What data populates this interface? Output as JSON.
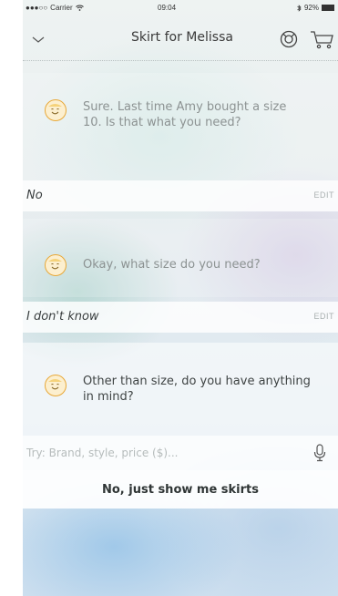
{
  "status_bar": {
    "signal": "●●●○○",
    "carrier": "Carrier",
    "time": "09:04",
    "battery_text": "92%"
  },
  "nav": {
    "title": "Skirt for Melissa"
  },
  "conversation": [
    {
      "bot": "Sure. Last time Amy bought a size 10. Is that what you need?",
      "answer": "No",
      "edit": "EDIT"
    },
    {
      "bot": "Okay, what size do you need?",
      "answer": "I don't know",
      "edit": "EDIT"
    },
    {
      "bot": "Other than size, do you have anything in mind?"
    }
  ],
  "input": {
    "placeholder": "Try: Brand, style, price ($)..."
  },
  "suggestion_button": "No, just show me skirts",
  "colors": {
    "avatar_ring": "#e8a838",
    "avatar_fill": "#fcefcf",
    "text_muted": "#8c9292",
    "text_dark": "#3f4444"
  },
  "icons": {
    "back": "chevron-down-icon",
    "help": "lifebuoy-icon",
    "cart": "cart-icon",
    "mic": "microphone-icon",
    "avatar": "smiley-avatar-icon"
  }
}
